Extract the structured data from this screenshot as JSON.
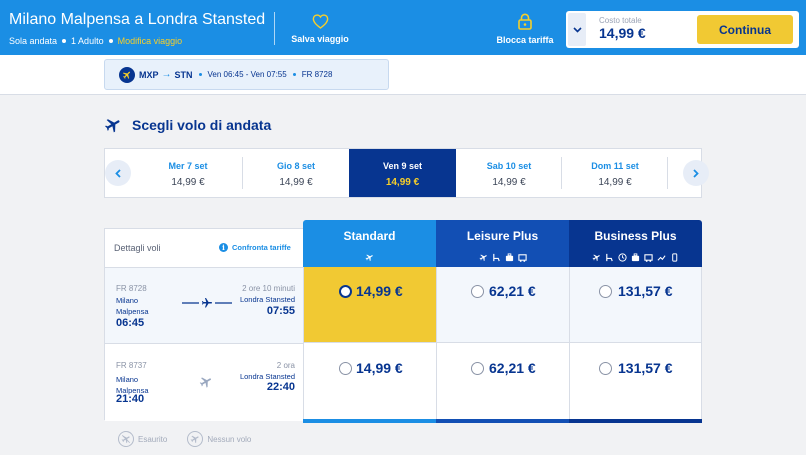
{
  "header": {
    "title": "Milano Malpensa a Londra Stansted",
    "trip_type": "Sola andata",
    "passengers": "1 Adulto",
    "modify_label": "Modifica viaggio",
    "save_label": "Salva viaggio",
    "lock_label": "Blocca tariffa",
    "total_label": "Costo totale",
    "total_value": "14,99 €",
    "continue_label": "Continua",
    "accent_color": "#1b8ee4",
    "cta_color": "#f1c933"
  },
  "flight_summary": {
    "origin_code": "MXP",
    "dest_code": "STN",
    "times": "Ven 06:45 - Ven 07:55",
    "flight_number": "FR 8728"
  },
  "section": {
    "title": "Scegli volo di andata"
  },
  "dates": [
    {
      "label": "Mer 7 set",
      "price": "14,99 €"
    },
    {
      "label": "Gio 8 set",
      "price": "14,99 €"
    },
    {
      "label": "Ven 9 set",
      "price": "14,99 €",
      "active": true
    },
    {
      "label": "Sab 10 set",
      "price": "14,99 €"
    },
    {
      "label": "Dom 11 set",
      "price": "14,99 €"
    }
  ],
  "table": {
    "details_label": "Dettagli voli",
    "compare_label": "Confronta tariffe",
    "fares": [
      {
        "name": "Standard",
        "icons": [
          "plane-icon"
        ]
      },
      {
        "name": "Leisure Plus",
        "icons": [
          "plane-icon",
          "seat-icon",
          "bag-icon",
          "luggage-icon"
        ]
      },
      {
        "name": "Business Plus",
        "icons": [
          "plane-icon",
          "seat-icon",
          "clock-icon",
          "bag-icon",
          "luggage-icon",
          "priority-icon",
          "mobile-icon"
        ]
      }
    ],
    "flights": [
      {
        "number": "FR 8728",
        "origin": "Milano Malpensa",
        "departure": "06:45",
        "duration": "2 ore 10 minuti",
        "destination": "Londra Stansted",
        "arrival": "07:55",
        "prices": [
          "14,99 €",
          "62,21 €",
          "131,57 €"
        ],
        "selected_fare": 0
      },
      {
        "number": "FR 8737",
        "origin": "Milano Malpensa",
        "departure": "21:40",
        "duration": "2 ora",
        "destination": "Londra Stansted",
        "arrival": "22:40",
        "prices": [
          "14,99 €",
          "62,21 €",
          "131,57 €"
        ]
      }
    ]
  },
  "legend": {
    "sold_out": "Esaurito",
    "no_flight": "Nessun volo"
  }
}
